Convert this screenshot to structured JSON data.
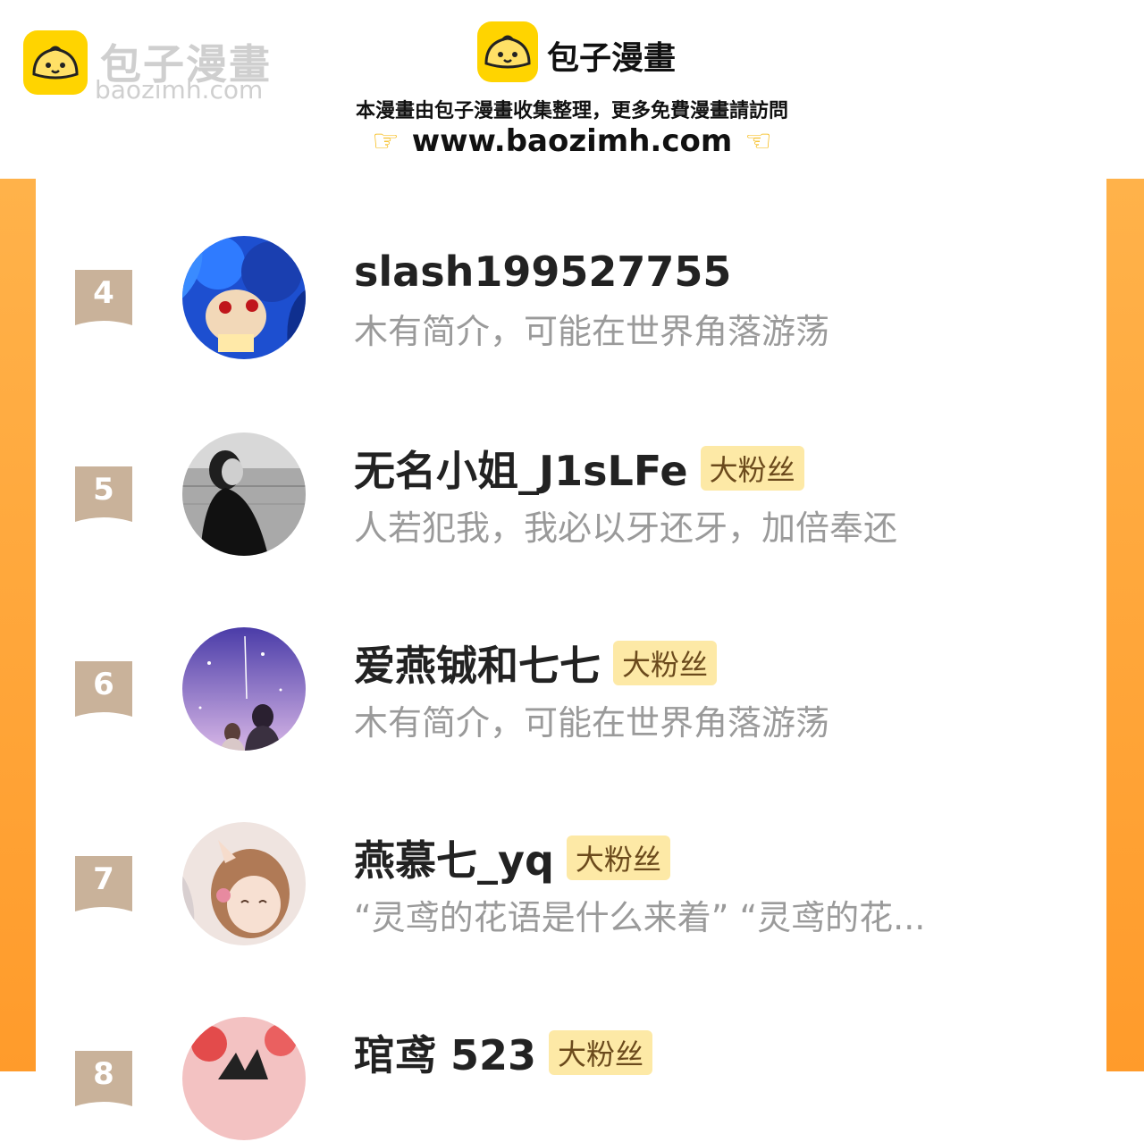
{
  "watermark": {
    "title": "包子漫畫",
    "url": "baozimh.com"
  },
  "brand": {
    "name": "包子漫畫"
  },
  "tagline": "本漫畫由包子漫畫收集整理，更多免費漫畫請訪問",
  "site_url": "www.baozimh.com",
  "icons": {
    "left_hand": "pointing-right-hand-icon",
    "right_hand": "pointing-left-hand-icon",
    "logo": "steamed-bun-icon"
  },
  "colors": {
    "accent": "#ff9b2b",
    "rank_tag": "#c9b29a",
    "badge_bg": "#fde9a6"
  },
  "ranking": [
    {
      "rank": "4",
      "name": "slash199527755",
      "badge": "",
      "bio": "木有简介，可能在世界角落游荡"
    },
    {
      "rank": "5",
      "name": "无名小姐_J1sLFe",
      "badge": "大粉丝",
      "bio": "人若犯我，我必以牙还牙，加倍奉还"
    },
    {
      "rank": "6",
      "name": "爱燕铖和七七",
      "badge": "大粉丝",
      "bio": "木有简介，可能在世界角落游荡"
    },
    {
      "rank": "7",
      "name": "燕慕七_yq",
      "badge": "大粉丝",
      "bio": "“灵鸢的花语是什么来着” “灵鸢的花..."
    },
    {
      "rank": "8",
      "name": "琯鸢 523",
      "badge": "大粉丝",
      "bio": ""
    }
  ]
}
